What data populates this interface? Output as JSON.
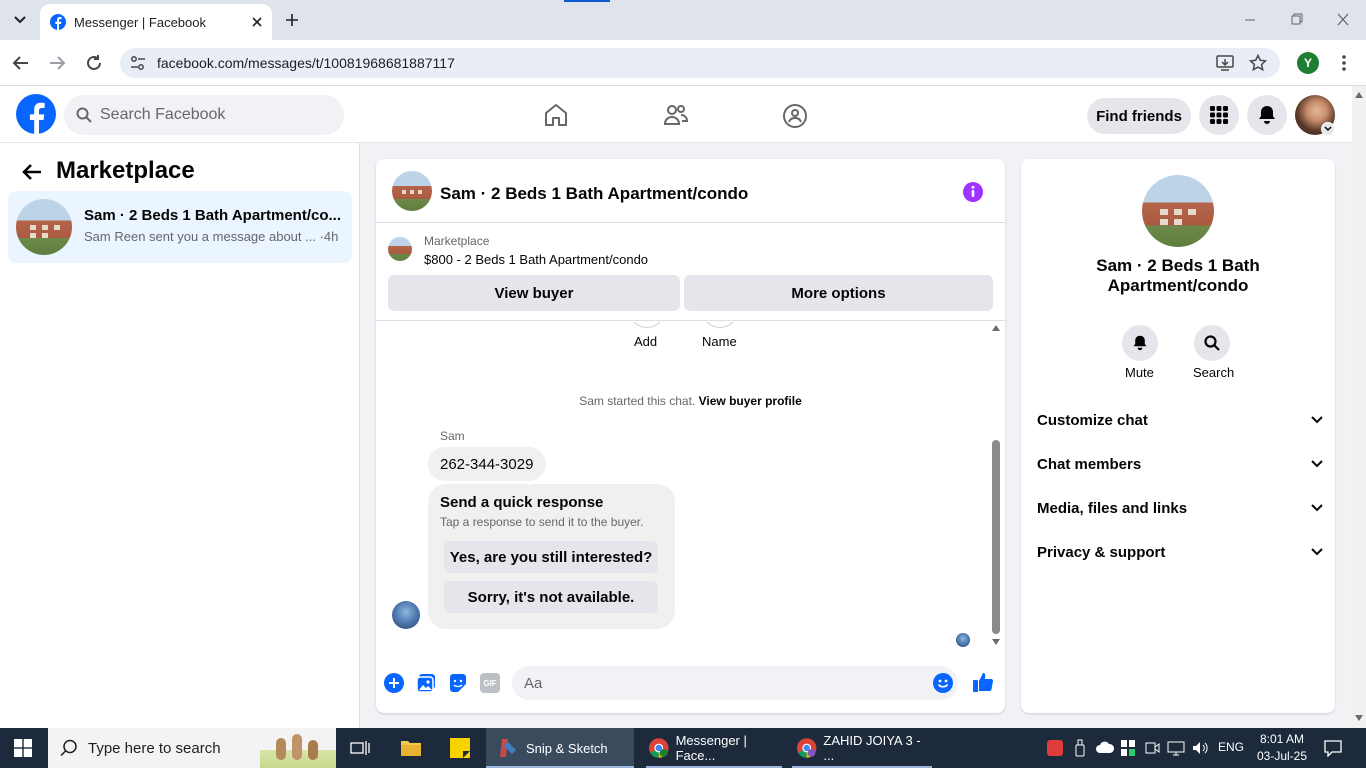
{
  "browser": {
    "tab_title": "Messenger | Facebook",
    "url": "facebook.com/messages/t/10081968681887117",
    "profile_letter": "Y"
  },
  "fb": {
    "search_placeholder": "Search Facebook",
    "find_friends": "Find friends"
  },
  "left": {
    "title": "Marketplace",
    "conversation": {
      "name": "Sam · 2 Beds 1 Bath Apartment/co...",
      "snippet": "Sam Reen sent you a message about ...",
      "time": "·4h"
    }
  },
  "chat": {
    "title": "Sam · 2 Beds 1 Bath Apartment/condo",
    "listing_label": "Marketplace",
    "listing_title": "$800 - 2 Beds 1 Bath Apartment/condo",
    "view_buyer": "View buyer",
    "more_options": "More options",
    "add_label": "Add",
    "name_label": "Name",
    "started_text": "Sam started this chat.",
    "view_profile": "View buyer profile",
    "sender": "Sam",
    "message": "262-344-3029",
    "quick_title": "Send a quick response",
    "quick_sub": "Tap a response to send it to the buyer.",
    "quick_1": "Yes, are you still interested?",
    "quick_2": "Sorry, it's not available.",
    "composer_placeholder": "Aa",
    "gif": "GIF"
  },
  "info": {
    "title_line1": "Sam · 2 Beds 1 Bath",
    "title_line2": "Apartment/condo",
    "mute": "Mute",
    "search": "Search",
    "sections": [
      "Customize chat",
      "Chat members",
      "Media, files and links",
      "Privacy & support"
    ]
  },
  "taskbar": {
    "search_placeholder": "Type here to search",
    "snip": "Snip & Sketch",
    "messenger": "Messenger | Face...",
    "zahid": "ZAHID JOIYA 3 - ...",
    "lang": "ENG",
    "time": "8:01 AM",
    "date": "03-Jul-25"
  },
  "colors": {
    "fb_blue": "#0866ff",
    "purple": "#a033ff",
    "active_conversation": "#ebf5ff"
  }
}
